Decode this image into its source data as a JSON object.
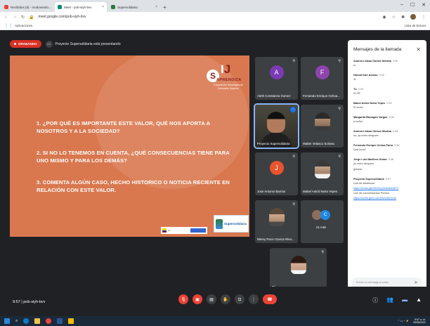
{
  "browser": {
    "tabs": [
      {
        "label": "Recibidos (8) - modoviredo...",
        "favicon_color": "#ea4335",
        "active": false
      },
      {
        "label": "Meet - pob-siyh-bvv",
        "favicon_color": "#00897b",
        "active": true
      },
      {
        "label": "Supersolidaria",
        "favicon_color": "#2a7a3d",
        "active": false
      }
    ],
    "url": "meet.google.com/pob-siyh-bvv",
    "bookmarks_apps": "Aplicaciones",
    "reading_list": "Lista de lectura"
  },
  "meet": {
    "recording_label": "GRABANDO",
    "presenting_note": "Proyecto Supersolidaria está presentando",
    "meeting_time": "9:57",
    "meeting_code": "pob-siyh-bvv"
  },
  "slide": {
    "questions": [
      [
        "1.  ¿POR QUÉ ES IMPORTANTE ESTE VALOR, QUÉ NOS APORTA A",
        "NOSOTROS Y A LA SOCIEDAD?"
      ],
      [
        "2. SI NO LO TENEMOS EN CUENTA, ¿QUÉ CONSECUENCIAS TIENE PARA",
        "UNO MISMO Y PARA LOS DEMÁS?"
      ],
      [
        "3. COMENTA ALGÚN CASO, HECHO HISTORICO O NOTICIA RECIENTE EN",
        "RELACIÓN CON ESTE VALOR."
      ]
    ],
    "logo_name": "APRENDIZA",
    "logo_sub": "Corporación Tecnológica de Educación Superior",
    "super_logo_text": "Supersolidaria"
  },
  "participants": [
    {
      "name": "Aleth Constanza Gomez",
      "initial": "A",
      "color": "#7b3ab5"
    },
    {
      "name": "Fernando Enrique Ochoa...",
      "initial": "F",
      "color": "#8e44ad"
    },
    {
      "name": "Proyecto Supersolidaria",
      "initial": "",
      "color": ""
    },
    {
      "name": "Walter Velasco Soriano",
      "initial": "",
      "color": ""
    },
    {
      "name": "Jose Antonio Barrios",
      "initial": "J",
      "color": "#e8542e"
    },
    {
      "name": "Mabel Astrid Neira Yepes",
      "initial": "",
      "color": ""
    },
    {
      "name": "Merey Rocio Garcia Riva...",
      "initial": "",
      "color": ""
    },
    {
      "name": "21 más",
      "initial": "C",
      "color": "#1e88e5"
    },
    {
      "name": "Tú",
      "initial": "",
      "color": ""
    }
  ],
  "chat": {
    "title": "Mensajes de la llamada",
    "input_placeholder": "Envía un mensaje a todos",
    "messages": [
      {
        "sender": "Andrea Liliana Gómez Medina",
        "time": "9:30",
        "lines": [
          "si"
        ]
      },
      {
        "sender": "Harold Ivan Arenas",
        "time": "9:30",
        "lines": [
          "Si"
        ]
      },
      {
        "sender": "Tú",
        "time": "9:30",
        "lines": [
          "Si SR"
        ]
      },
      {
        "sender": "Mabel Astrid Neira Yepes",
        "time": "9:34",
        "lines": [
          "Si señor"
        ]
      },
      {
        "sender": "Margarita Barragan Vargas",
        "time": "9:35",
        "lines": [
          "si señor"
        ]
      },
      {
        "sender": "Andrea Liliana Gómez Medina",
        "time": "9:35",
        "lines": [
          "no, yo entro despues"
        ]
      },
      {
        "sender": "Fernando Enrique Ochoa Parra",
        "time": "9:36",
        "lines": [
          "Qué hora?"
        ]
      },
      {
        "sender": "Jorge Luis Martinez Duran",
        "time": "9:36",
        "lines": [
          "yo entre despues"
        ]
      },
      {
        "sender": "",
        "time": "",
        "lines": [
          "gracias"
        ]
      },
      {
        "sender": "Proyecto Supersolidaria",
        "time": "9:37",
        "lines": [
          "Link de asistencia"
        ],
        "links": [
          "https://forms.gle/2WnGyJGzMzduiZ73"
        ],
        "lines2": [
          "Link de conocimientos Previos"
        ],
        "links2": [
          "https://forms.gle/LUaVthUhn6E1cuE"
        ]
      }
    ]
  },
  "taskbar": {
    "clock_time": "9:57 a. m.",
    "clock_date": "25/08/2021"
  },
  "colors": {
    "slide_bg": "#d9784f",
    "accent_red": "#ea4335",
    "meet_bg": "#202124"
  }
}
